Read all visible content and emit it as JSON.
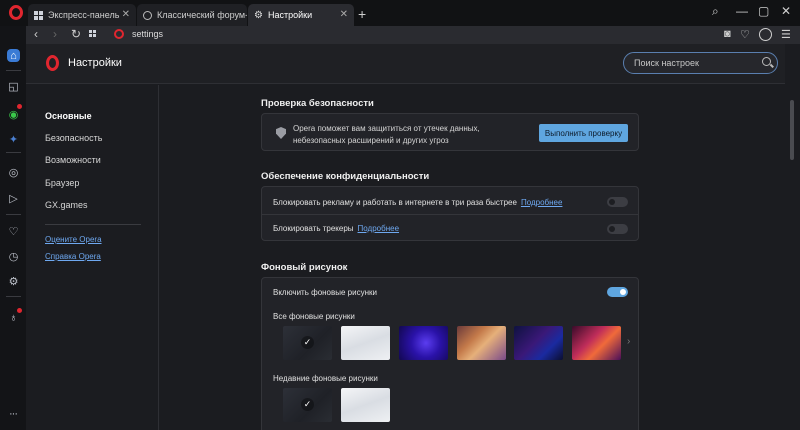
{
  "tabs": [
    {
      "label": "Экспресс-панель",
      "active": false
    },
    {
      "label": "Классический форум-трек",
      "active": false
    },
    {
      "label": "Настройки",
      "active": true
    }
  ],
  "address_bar": {
    "url": "settings"
  },
  "header": {
    "title": "Настройки",
    "search_placeholder": "Поиск настроек"
  },
  "nav": {
    "items": [
      "Основные",
      "Безопасность",
      "Возможности",
      "Браузер",
      "GX.games"
    ],
    "links": [
      "Оцените Opera",
      "Справка Opera"
    ]
  },
  "security_check": {
    "title": "Проверка безопасности",
    "text": "Opera поможет вам защититься от утечек данных, небезопасных расширений и других угроз",
    "button": "Выполнить проверку"
  },
  "privacy": {
    "title": "Обеспечение конфиденциальности",
    "rows": [
      {
        "label": "Блокировать рекламу и работать в интернете в три раза быстрее",
        "link": "Подробнее",
        "enabled": false
      },
      {
        "label": "Блокировать трекеры",
        "link": "Подробнее",
        "enabled": false
      }
    ]
  },
  "wallpaper": {
    "title": "Фоновый рисунок",
    "enable_label": "Включить фоновые рисунки",
    "enabled": true,
    "all_label": "Все фоновые рисунки",
    "recent_label": "Недавние фоновые рисунки"
  },
  "colors": {
    "accent": "#5fa6e0",
    "brand": "#e0262f",
    "link": "#6ea8f0"
  }
}
